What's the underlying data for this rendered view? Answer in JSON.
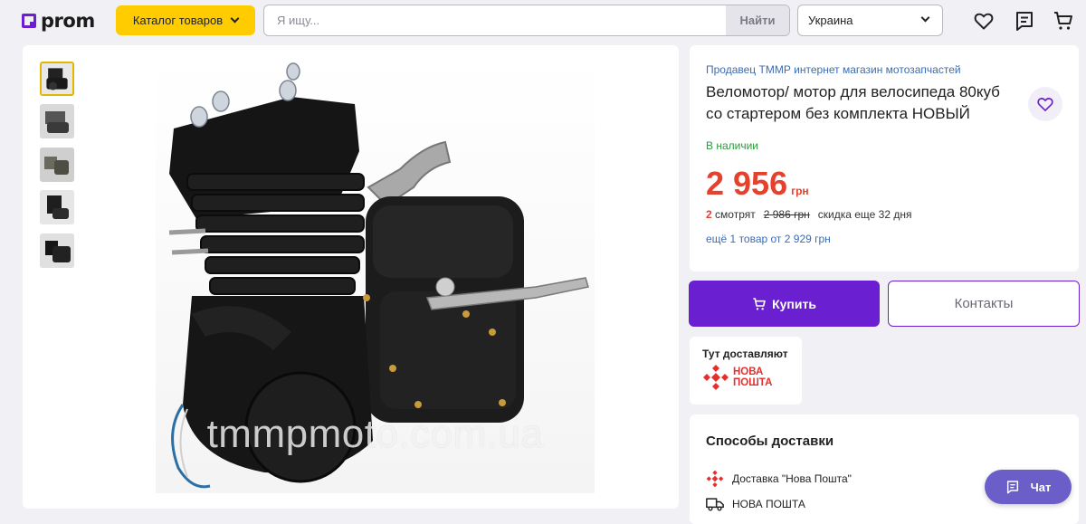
{
  "header": {
    "logo_text": "prom",
    "catalog_label": "Каталог товаров",
    "search_placeholder": "Я ищу...",
    "search_button": "Найти",
    "region": "Украина",
    "accent_color": "#6a1fd0",
    "catalog_color": "#ffcc00"
  },
  "gallery": {
    "thumbnails": [
      {
        "icon": "engine-thumb-1",
        "active": true
      },
      {
        "icon": "engine-thumb-2",
        "active": false
      },
      {
        "icon": "engine-thumb-3",
        "active": false
      },
      {
        "icon": "engine-thumb-4",
        "active": false
      },
      {
        "icon": "engine-thumb-5",
        "active": false
      }
    ],
    "watermark": "tmmpmoto.com.ua"
  },
  "product": {
    "seller": "Продавец ТММР интернет магазин мотозапчастей",
    "title": "Веломотор/ мотор для велосипеда 80куб со стартером без комплекта НОВЫЙ",
    "availability": "В наличии",
    "price": "2 956",
    "currency": "грн",
    "watching_count": "2",
    "watching_label": "смотрят",
    "old_price": "2 986 грн",
    "discount_note": "скидка еще 32 дня",
    "more_offers": "ещё 1 товар от 2 929 грн",
    "price_color": "#e5412d",
    "stock_color": "#2a9a3a"
  },
  "actions": {
    "buy_label": "Купить",
    "contacts_label": "Контакты"
  },
  "delivery_badge": {
    "label": "Тут доставляют",
    "carrier_line1": "НОВА",
    "carrier_line2": "ПОШТА"
  },
  "delivery": {
    "heading": "Способы доставки",
    "methods": [
      {
        "label": "Доставка \"Нова Пошта\"",
        "icon": "nova-poshta-icon"
      },
      {
        "label": "НОВА ПОШТА",
        "icon": "truck-icon"
      }
    ]
  },
  "chat": {
    "label": "Чат"
  }
}
